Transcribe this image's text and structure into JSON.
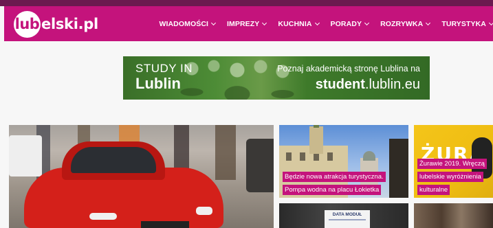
{
  "site": {
    "logo_circle": "lub",
    "logo_rest": "elski.pl"
  },
  "nav": {
    "items": [
      {
        "label": "WIADOMOŚCI"
      },
      {
        "label": "IMPREZY"
      },
      {
        "label": "KUCHNIA"
      },
      {
        "label": "PORADY"
      },
      {
        "label": "ROZRYWKA"
      },
      {
        "label": "TURYSTYKA"
      }
    ]
  },
  "banner": {
    "left_line1": "STUDY IN",
    "left_line2": "Lublin",
    "right_line1": "Poznaj akademicką stronę Lublina na",
    "right_line2_bold": "student",
    "right_line2_rest": ".lublin.eu"
  },
  "tiles": {
    "a": {
      "caption": "Będzie nowa atrakcja turystyczna. Pompa wodna na placu Łokietka"
    },
    "b": {
      "caption": "Żurawie 2019. Wręczą lubelskie wyróżnienia kulturalne",
      "overlay": "ŻURA"
    },
    "c": {
      "screen_text": "DATA MODUŁ"
    }
  },
  "colors": {
    "brand": "#c4137c",
    "header_dark": "#6b1a4f",
    "banner_green": "#3f7a2c",
    "background": "#f7f7f7"
  },
  "icons": {
    "nav_dropdown": "chevron-down-icon"
  }
}
